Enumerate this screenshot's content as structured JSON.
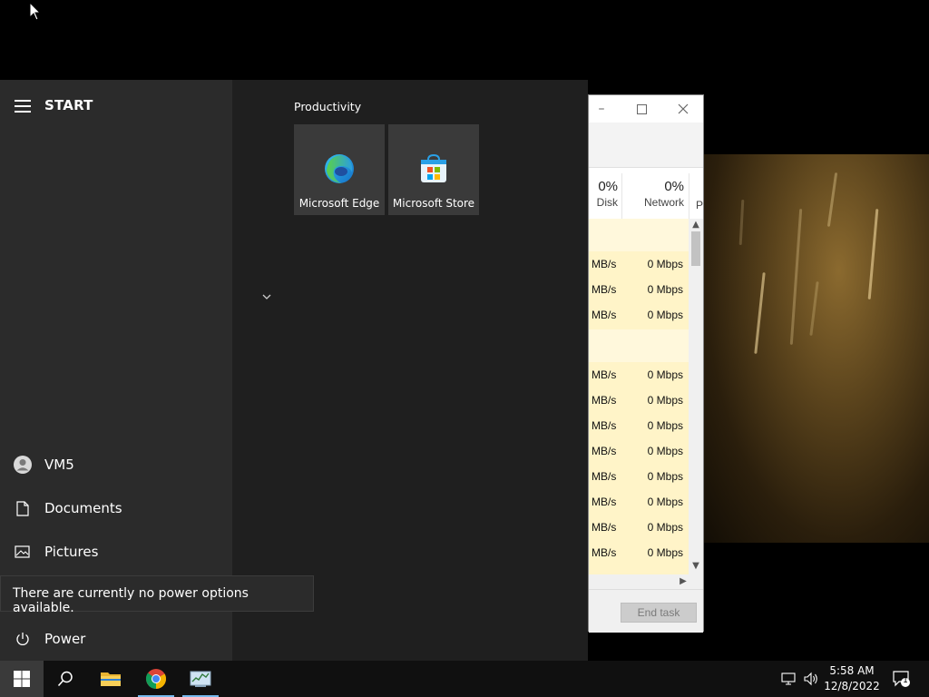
{
  "start_menu": {
    "title": "START",
    "group_title": "Productivity",
    "tiles": [
      {
        "label": "Microsoft Edge"
      },
      {
        "label": "Microsoft Store"
      }
    ],
    "left_items": {
      "user": "VM5",
      "documents": "Documents",
      "pictures": "Pictures",
      "power": "Power"
    },
    "tooltip": "There are currently no power options available."
  },
  "task_manager": {
    "columns": {
      "disk": {
        "percent": "0%",
        "label": "Disk"
      },
      "network": {
        "percent": "0%",
        "label": "Network"
      },
      "partial": "P"
    },
    "rows": [
      {
        "disk": "MB/s",
        "network": "0 Mbps"
      },
      {
        "disk": "MB/s",
        "network": "0 Mbps"
      },
      {
        "disk": "MB/s",
        "network": "0 Mbps"
      },
      {
        "disk": "MB/s",
        "network": "0 Mbps"
      },
      {
        "disk": "MB/s",
        "network": "0 Mbps"
      },
      {
        "disk": "MB/s",
        "network": "0 Mbps"
      },
      {
        "disk": "MB/s",
        "network": "0 Mbps"
      },
      {
        "disk": "MB/s",
        "network": "0 Mbps"
      },
      {
        "disk": "MB/s",
        "network": "0 Mbps"
      },
      {
        "disk": "MB/s",
        "network": "0 Mbps"
      },
      {
        "disk": "MB/s",
        "network": "0 Mbps"
      }
    ],
    "end_task_label": "End task"
  },
  "taskbar": {
    "time": "5:58 AM",
    "date": "12/8/2022",
    "notification_count": "1"
  },
  "colors": {
    "start_left": "#2b2b2b",
    "start_right": "#1f1f1f",
    "accent": "#76b9ed",
    "tm_highlight": "#fff4c8"
  }
}
